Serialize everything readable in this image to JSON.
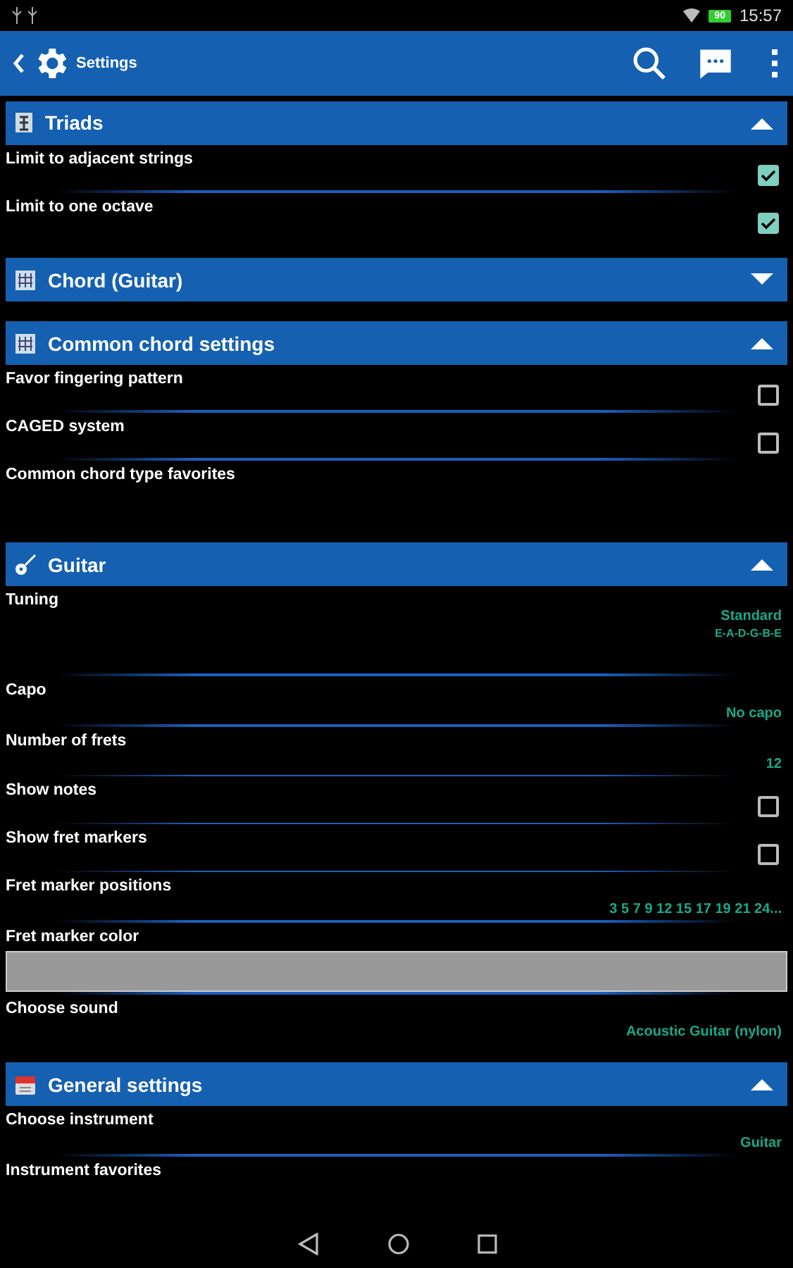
{
  "status_bar": {
    "battery": "90",
    "time": "15:57"
  },
  "app_bar": {
    "title": "Settings"
  },
  "sections": [
    {
      "title": "Triads",
      "expanded": true,
      "rows": [
        {
          "kind": "checkbox",
          "label": "Limit to adjacent strings",
          "checked": true
        },
        {
          "kind": "checkbox",
          "label": "Limit to one octave",
          "checked": true
        }
      ]
    },
    {
      "title": "Chord (Guitar)",
      "expanded": false
    },
    {
      "title": "Common chord settings",
      "expanded": true,
      "rows": [
        {
          "kind": "checkbox",
          "label": "Favor fingering pattern",
          "checked": false
        },
        {
          "kind": "checkbox",
          "label": "CAGED system",
          "checked": false
        },
        {
          "kind": "plain",
          "label": "Common chord type favorites"
        }
      ]
    },
    {
      "title": "Guitar",
      "expanded": true,
      "rows": [
        {
          "kind": "value",
          "label": "Tuning",
          "value": "Standard",
          "detail": "E-A-D-G-B-E"
        },
        {
          "kind": "value",
          "label": "Capo",
          "value": "No capo"
        },
        {
          "kind": "value",
          "label": "Number of frets",
          "value": "12"
        },
        {
          "kind": "checkbox",
          "label": "Show notes",
          "checked": false
        },
        {
          "kind": "checkbox",
          "label": "Show fret markers",
          "checked": false
        },
        {
          "kind": "value",
          "label": "Fret marker positions",
          "value": "3 5 7 9 12 15 17 19 21 24..."
        },
        {
          "kind": "color",
          "label": "Fret marker color",
          "color": "#999999"
        },
        {
          "kind": "value",
          "label": "Choose sound",
          "value": "Acoustic Guitar (nylon)"
        }
      ]
    },
    {
      "title": "General settings",
      "expanded": true,
      "rows": [
        {
          "kind": "value",
          "label": "Choose instrument",
          "value": "Guitar"
        },
        {
          "kind": "plain",
          "label": "Instrument favorites"
        }
      ]
    }
  ]
}
